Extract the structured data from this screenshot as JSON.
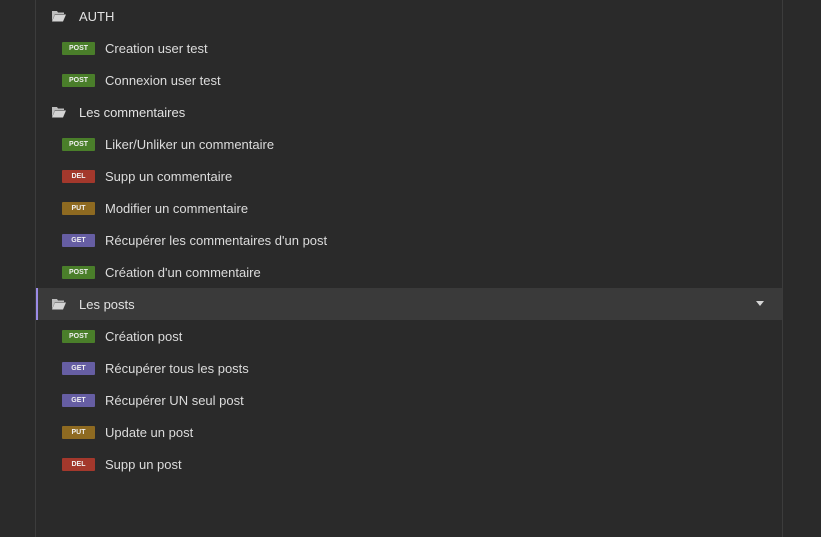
{
  "folders": [
    {
      "name": "AUTH",
      "requests": [
        {
          "method": "POST",
          "name": "Creation user test"
        },
        {
          "method": "POST",
          "name": "Connexion user test"
        }
      ]
    },
    {
      "name": "Les commentaires",
      "requests": [
        {
          "method": "POST",
          "name": "Liker/Unliker un commentaire"
        },
        {
          "method": "DEL",
          "name": "Supp un commentaire"
        },
        {
          "method": "PUT",
          "name": "Modifier un commentaire"
        },
        {
          "method": "GET",
          "name": "Récupérer les commentaires d'un post"
        },
        {
          "method": "POST",
          "name": "Création d'un commentaire"
        }
      ]
    },
    {
      "name": "Les posts",
      "requests": [
        {
          "method": "POST",
          "name": "Création post"
        },
        {
          "method": "GET",
          "name": "Récupérer tous les posts"
        },
        {
          "method": "GET",
          "name": "Récupérer UN seul post"
        },
        {
          "method": "PUT",
          "name": "Update un post"
        },
        {
          "method": "DEL",
          "name": "Supp un post"
        }
      ]
    }
  ],
  "colors": {
    "POST": "#4a7e2a",
    "GET": "#665ea3",
    "PUT": "#8e6a21",
    "DEL": "#a3382c",
    "accent": "#9b8be6"
  },
  "icons": {
    "folder": "folder-open-icon",
    "caret": "caret-down-icon"
  }
}
